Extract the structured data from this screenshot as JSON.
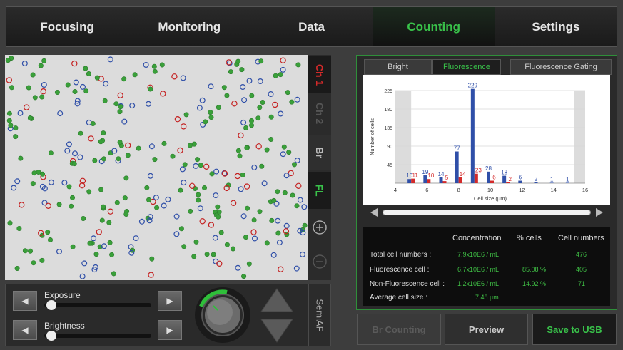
{
  "nav": {
    "tabs": [
      {
        "label": "Focusing"
      },
      {
        "label": "Monitoring"
      },
      {
        "label": "Data"
      },
      {
        "label": "Counting"
      },
      {
        "label": "Settings"
      }
    ],
    "active": "Counting"
  },
  "channels": {
    "ch1": "Ch 1",
    "ch2": "Ch 2",
    "br": "Br",
    "fl": "FL",
    "zoom_in_icon": "plus-icon",
    "zoom_out_icon": "minus-icon"
  },
  "controls": {
    "exposure_label": "Exposure",
    "exposure_level": 0.02,
    "brightness_label": "Brightness",
    "brightness_level": 0.02,
    "semiaf_label": "SemiAF",
    "focus_knob_icon": "focus-knob-icon",
    "up_icon": "triangle-up-icon",
    "down_icon": "triangle-down-icon"
  },
  "right_tabs": [
    "Bright",
    "Fluorescence",
    "Fluorescence Gating"
  ],
  "right_active": "Fluorescence",
  "chart_data": {
    "type": "bar",
    "xlabel": "Cell size (µm)",
    "ylabel": "Number of cells",
    "xlim": [
      4,
      16
    ],
    "ylim": [
      0,
      225
    ],
    "xticks": [
      4,
      6,
      8,
      10,
      12,
      14,
      16
    ],
    "yticks": [
      45,
      90,
      135,
      180,
      225
    ],
    "gate_ranges": [
      [
        4,
        5
      ],
      [
        15.3,
        16
      ]
    ],
    "bins": [
      5,
      6,
      7,
      8,
      9,
      10,
      11,
      12,
      13,
      14,
      15
    ],
    "series": [
      {
        "color": "#2f4fa8",
        "values": [
          10,
          19,
          14,
          77,
          229,
          28,
          18,
          6,
          2,
          1,
          1
        ]
      },
      {
        "color": "#d42a2a",
        "values": [
          11,
          10,
          5,
          14,
          23,
          6,
          2,
          0,
          0,
          0,
          0
        ]
      }
    ],
    "labels_blue": [
      "10",
      "19",
      "14",
      "77",
      "229",
      "28",
      "18",
      "6",
      "2",
      "1",
      "1"
    ],
    "labels_red": [
      "11",
      "10",
      "5",
      "14",
      "23",
      "6",
      "2",
      "",
      "",
      "",
      ""
    ]
  },
  "stats": {
    "headers": [
      "Concentration",
      "% cells",
      "Cell numbers"
    ],
    "rows": [
      {
        "label": "Total cell numbers :",
        "conc": "7.9x10E6 / mL",
        "pct": "",
        "num": "476"
      },
      {
        "label": "Fluorescence cell :",
        "conc": "6.7x10E6 / mL",
        "pct": "85.08 %",
        "num": "405"
      },
      {
        "label": "Non-Fluorescence cell :",
        "conc": "1.2x10E6 / mL",
        "pct": "14.92 %",
        "num": "71"
      },
      {
        "label": "Average cell size :",
        "conc": "7.48 µm",
        "pct": "",
        "num": ""
      }
    ]
  },
  "buttons": {
    "br_counting": "Br Counting",
    "preview": "Preview",
    "save_usb": "Save to USB"
  }
}
